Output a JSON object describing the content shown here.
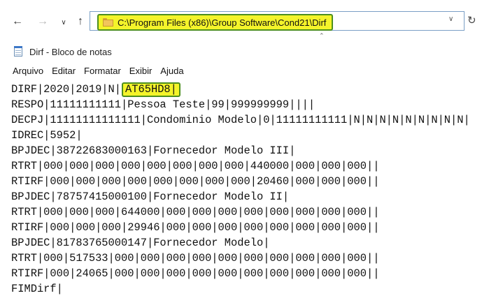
{
  "explorer": {
    "address_path": "C:\\Program Files (x86)\\Group Software\\Cond21\\Dirf",
    "nav": {
      "back_icon": "arrow-left-icon",
      "forward_icon": "arrow-right-icon",
      "recent_icon": "chevron-down-icon",
      "up_icon": "arrow-up-icon",
      "refresh_icon": "refresh-icon"
    }
  },
  "notepad": {
    "title": "Dirf - Bloco de notas",
    "menu": [
      {
        "label": "Arquivo"
      },
      {
        "label": "Editar"
      },
      {
        "label": "Formatar"
      },
      {
        "label": "Exibir"
      },
      {
        "label": "Ajuda"
      }
    ],
    "first_line_prefix": "DIRF|2020|2019|N|",
    "first_line_highlight": "AT65HD8|",
    "lines": [
      "RESPO|11111111111|Pessoa Teste|99|999999999||||",
      "DECPJ|11111111111111|Condominio Modelo|0|11111111111|N|N|N|N|N|N|N|N|N|",
      "IDREC|5952|",
      "BPJDEC|38722683000163|Fornecedor Modelo III|",
      "RTRT|000|000|000|000|000|000|000|000|440000|000|000|000||",
      "RTIRF|000|000|000|000|000|000|000|000|20460|000|000|000||",
      "BPJDEC|78757415000100|Fornecedor Modelo II|",
      "RTRT|000|000|000|644000|000|000|000|000|000|000|000|000||",
      "RTIRF|000|000|000|29946|000|000|000|000|000|000|000|000||",
      "BPJDEC|81783765000147|Fornecedor Modelo|",
      "RTRT|000|517533|000|000|000|000|000|000|000|000|000|000||",
      "RTIRF|000|24065|000|000|000|000|000|000|000|000|000|000||",
      "FIMDirf|"
    ]
  },
  "colors": {
    "highlight_fill": "#f4f42a",
    "highlight_border": "#4d8f1e",
    "address_border": "#7a9fc6"
  }
}
